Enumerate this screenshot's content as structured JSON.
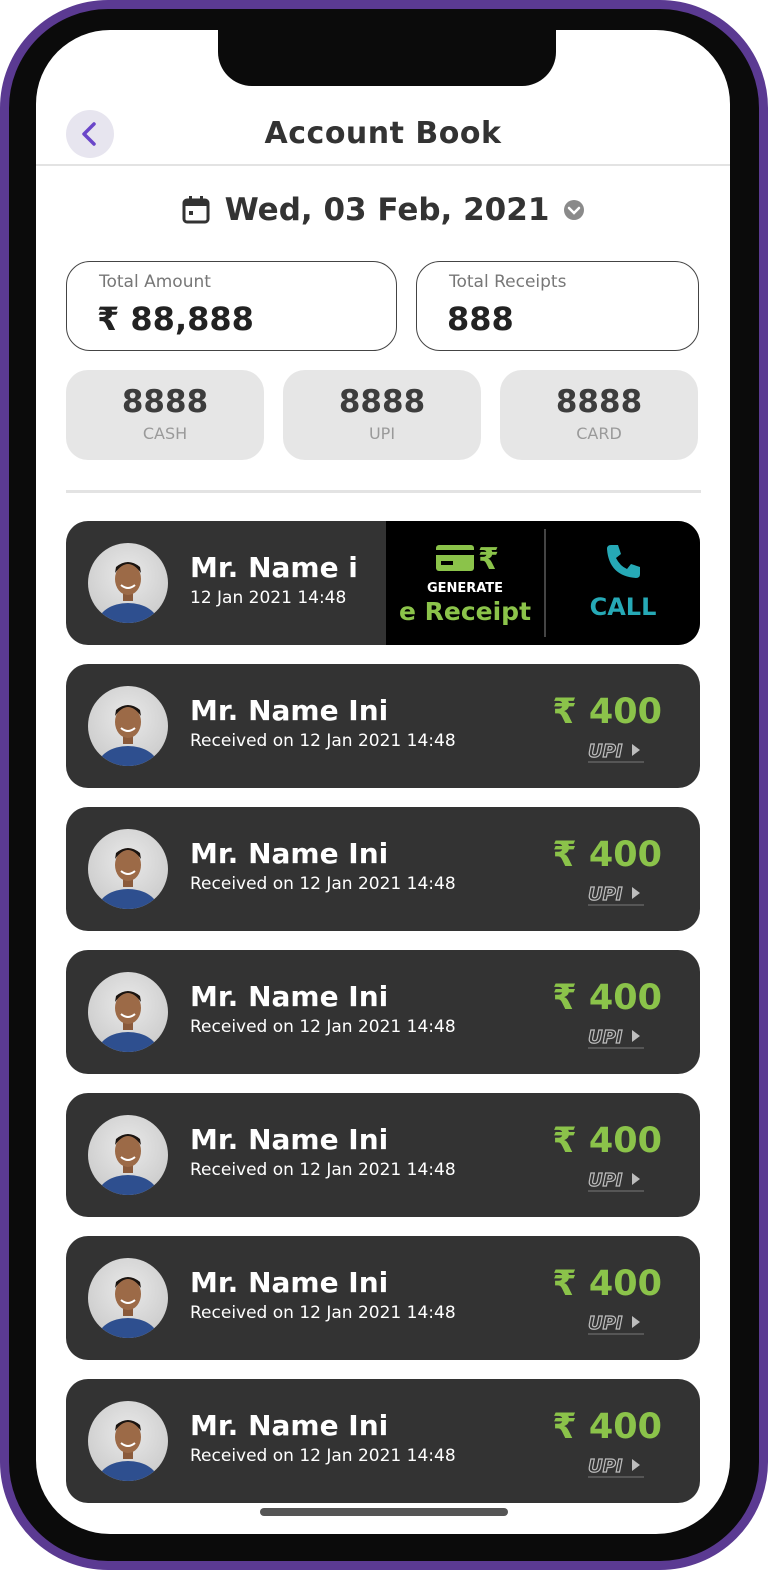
{
  "header": {
    "title": "Account Book"
  },
  "date": {
    "value": "Wed, 03 Feb, 2021"
  },
  "totals": {
    "amount_label": "Total Amount",
    "amount_value": "₹ 88,888",
    "receipts_label": "Total Receipts",
    "receipts_value": "888"
  },
  "breakdown": [
    {
      "value": "8888",
      "label": "CASH"
    },
    {
      "value": "8888",
      "label": "UPI"
    },
    {
      "value": "8888",
      "label": "CARD"
    }
  ],
  "active_card": {
    "name": "Mr. Name i",
    "datetime": "12 Jan 2021 14:48",
    "generate_label": "GENERATE",
    "receipt_label": "e Receipt",
    "call_label": "CALL"
  },
  "transactions": [
    {
      "name": "Mr. Name Ini",
      "received": "Received on 12 Jan 2021 14:48",
      "amount": "₹ 400",
      "method": "UPI"
    },
    {
      "name": "Mr. Name Ini",
      "received": "Received on 12 Jan 2021 14:48",
      "amount": "₹ 400",
      "method": "UPI"
    },
    {
      "name": "Mr. Name Ini",
      "received": "Received on 12 Jan 2021 14:48",
      "amount": "₹ 400",
      "method": "UPI"
    },
    {
      "name": "Mr. Name Ini",
      "received": "Received on 12 Jan 2021 14:48",
      "amount": "₹ 400",
      "method": "UPI"
    },
    {
      "name": "Mr. Name Ini",
      "received": "Received on 12 Jan 2021 14:48",
      "amount": "₹ 400",
      "method": "UPI"
    },
    {
      "name": "Mr. Name Ini",
      "received": "Received on 12 Jan 2021 14:48",
      "amount": "₹ 400",
      "method": "UPI"
    }
  ],
  "colors": {
    "accent_green": "#8bc34a",
    "call_teal": "#26a9b6",
    "card_bg": "#333333",
    "frame": "#5b3a92"
  },
  "icons": {
    "back": "chevron-left-icon",
    "calendar": "calendar-icon",
    "dropdown": "chevron-down-icon",
    "receipt": "card-rupee-icon",
    "call": "phone-icon"
  }
}
